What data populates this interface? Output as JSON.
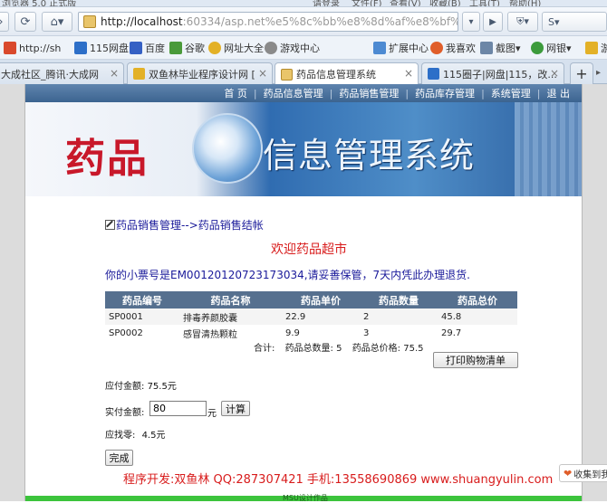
{
  "browser": {
    "titlebar": {
      "left_text": "浏览器 5.0 正式版",
      "right_items": [
        "请登录",
        "文件(F)",
        "查看(V)",
        "收藏(B)",
        "工具(T)",
        "帮助(H)"
      ]
    },
    "nav": {
      "address_host": "http://localhost",
      "address_rest": ":60334/asp.net%e5%8c%bb%e8%8d%af%e8%bf%9b%e9"
    },
    "bookmarks": [
      "http://sh",
      "115网盘",
      "百度",
      "谷歌",
      "网址大全",
      "游戏中心",
      "扩展中心",
      "我喜欢",
      "截图",
      "网银",
      "游"
    ],
    "tabs": [
      {
        "label": "大成社区_腾讯·大成网",
        "active": false
      },
      {
        "label": "双鱼林毕业程序设计网 [",
        "active": false
      },
      {
        "label": "药品信息管理系统",
        "active": true
      },
      {
        "label": "115圈子|网盘|115，改...",
        "active": false
      }
    ],
    "new_tab_label": "+"
  },
  "site": {
    "nav_items": [
      "首 页",
      "药品信息管理",
      "药品销售管理",
      "药品库存管理",
      "系统管理",
      "退 出"
    ],
    "banner": {
      "title_red": "药品",
      "title_white": "信息管理系统"
    },
    "breadcrumb": "药品销售管理-->药品销售结帐",
    "welcome": "欢迎药品超市",
    "receipt_text": "你的小票号是EM00120120723173034,请妥善保管，7天内凭此办理退货.",
    "table": {
      "headers": [
        "药品编号",
        "药品名称",
        "药品单价",
        "药品数量",
        "药品总价"
      ],
      "rows": [
        [
          "SP0001",
          "排毒养颜胶囊",
          "22.9",
          "2",
          "45.8"
        ],
        [
          "SP0002",
          "感冒清热颗粒",
          "9.9",
          "3",
          "29.7"
        ]
      ]
    },
    "totals": {
      "label": "合计:",
      "qty_label": "药品总数量:",
      "qty_value": "5",
      "price_label": "药品总价格:",
      "price_value": "75.5"
    },
    "print_button": "打印购物清单",
    "payable_label": "应付金额:",
    "payable_value": "75.5元",
    "paid_label": "实付金额:",
    "paid_value": "80",
    "paid_unit": "元",
    "calc_button": "计算",
    "change_label": "应找零:",
    "change_value": "4.5元",
    "done_button": "完成",
    "footer": "程序开发:双鱼林 QQ:287307421 手机:13558690869 www.shuangyulin.com",
    "bottom_text": "MSU设计作品"
  },
  "floating": {
    "favorite_label": "收集到我"
  },
  "colors": {
    "nav_bar": "#4a6f9b",
    "table_header": "#56708f",
    "accent_red": "#d81c1c",
    "link_blue": "#1a1a9a",
    "bottom_bar": "#3cc43c"
  }
}
